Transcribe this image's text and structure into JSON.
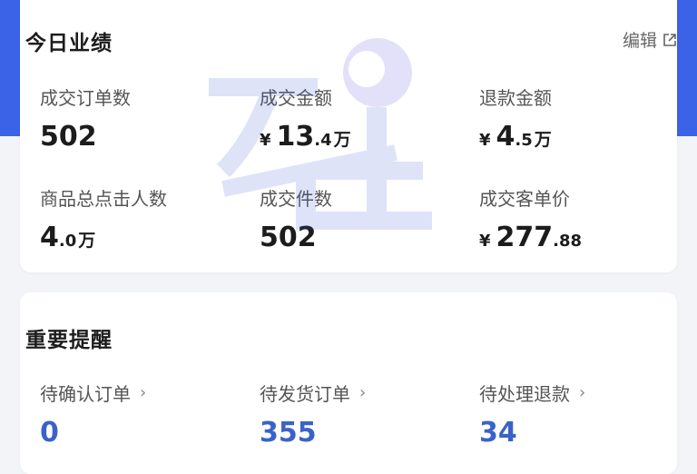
{
  "performance": {
    "title": "今日业绩",
    "edit_label": "编辑",
    "metrics": [
      {
        "label": "成交订单数",
        "main": "502",
        "small": "",
        "unit": "",
        "yen": ""
      },
      {
        "label": "成交金额",
        "yen": "¥",
        "main": "13",
        "small": ".4",
        "unit": "万"
      },
      {
        "label": "退款金额",
        "yen": "¥",
        "main": "4",
        "small": ".5",
        "unit": "万"
      },
      {
        "label": "商品总点击人数",
        "yen": "",
        "main": "4",
        "small": ".0",
        "unit": "万"
      },
      {
        "label": "成交件数",
        "yen": "",
        "main": "502",
        "small": "",
        "unit": ""
      },
      {
        "label": "成交客单价",
        "yen": "¥",
        "main": "277",
        "small": ".88",
        "unit": ""
      }
    ]
  },
  "reminders": {
    "title": "重要提醒",
    "items": [
      {
        "label": "待确认订单",
        "value": "0"
      },
      {
        "label": "待发货订单",
        "value": "355"
      },
      {
        "label": "待处理退款",
        "value": "34"
      }
    ]
  },
  "colors": {
    "header_blue": "#3a63e8",
    "value_blue": "#3a63c9"
  }
}
